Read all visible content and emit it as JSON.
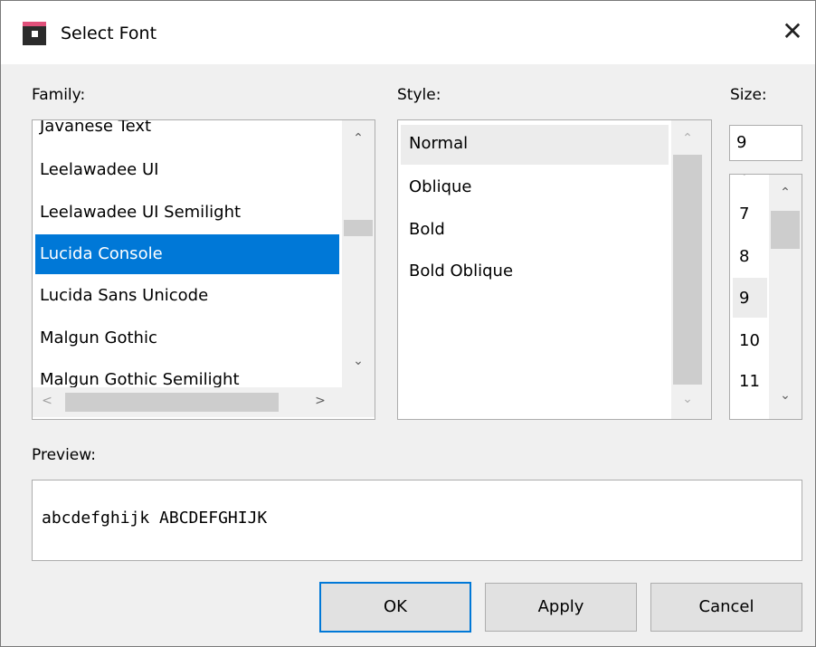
{
  "window": {
    "title": "Select Font",
    "close_glyph": "✕"
  },
  "labels": {
    "family": "Family:",
    "style": "Style:",
    "size": "Size:",
    "preview": "Preview:"
  },
  "family": {
    "items": [
      "Javanese Text",
      "Leelawadee UI",
      "Leelawadee UI Semilight",
      "Lucida Console",
      "Lucida Sans Unicode",
      "Malgun Gothic",
      "Malgun Gothic Semilight"
    ],
    "selected": "Lucida Console"
  },
  "style": {
    "items": [
      "Normal",
      "Oblique",
      "Bold",
      "Bold Oblique"
    ],
    "selected": "Normal"
  },
  "size": {
    "value": "9",
    "items": [
      "7",
      "8",
      "9",
      "10",
      "11"
    ],
    "selected": "9"
  },
  "preview": {
    "text": "abcdefghijk ABCDEFGHIJK"
  },
  "buttons": {
    "ok": "OK",
    "apply": "Apply",
    "cancel": "Cancel"
  },
  "glyphs": {
    "up": "⌃",
    "down": "⌄",
    "left": "<",
    "right": ">"
  },
  "colors": {
    "selection": "#0078d7",
    "dialog_bg": "#f0f0f0"
  }
}
